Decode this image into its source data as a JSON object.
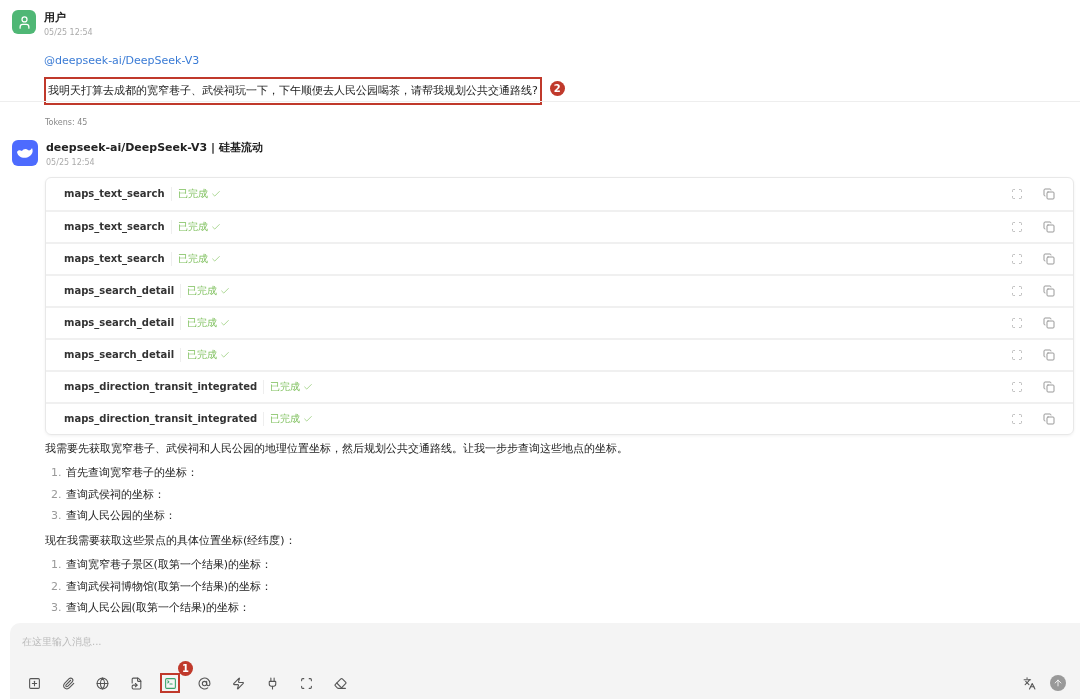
{
  "user_message": {
    "author": "用户",
    "time": "05/25 12:54",
    "mention": "@deepseek-ai/DeepSeek-V3",
    "text": "我明天打算去成都的宽窄巷子、武侯祠玩一下，下午顺便去人民公园喝茶，请帮我规划公共交通路线?",
    "annotation": "2",
    "tokens": "Tokens: 45"
  },
  "assistant_message": {
    "author": "deepseek-ai/DeepSeek-V3 | 硅基流动",
    "time": "05/25 12:54",
    "tool_calls": [
      {
        "name": "maps_text_search",
        "status": "已完成"
      },
      {
        "name": "maps_text_search",
        "status": "已完成"
      },
      {
        "name": "maps_text_search",
        "status": "已完成"
      },
      {
        "name": "maps_search_detail",
        "status": "已完成"
      },
      {
        "name": "maps_search_detail",
        "status": "已完成"
      },
      {
        "name": "maps_search_detail",
        "status": "已完成"
      },
      {
        "name": "maps_direction_transit_integrated",
        "status": "已完成"
      },
      {
        "name": "maps_direction_transit_integrated",
        "status": "已完成"
      }
    ],
    "blocks": [
      {
        "kind": "paragraph",
        "text": "我需要先获取宽窄巷子、武侯祠和人民公园的地理位置坐标，然后规划公共交通路线。让我一步步查询这些地点的坐标。"
      },
      {
        "kind": "list",
        "items": [
          {
            "number": "1.",
            "text": "首先查询宽窄巷子的坐标："
          },
          {
            "number": "2.",
            "text": "查询武侯祠的坐标："
          },
          {
            "number": "3.",
            "text": "查询人民公园的坐标："
          }
        ]
      },
      {
        "kind": "paragraph",
        "text": "现在我需要获取这些景点的具体位置坐标(经纬度)："
      },
      {
        "kind": "list",
        "items": [
          {
            "number": "1.",
            "text": "查询宽窄巷子景区(取第一个结果)的坐标："
          },
          {
            "number": "2.",
            "text": "查询武侯祠博物馆(取第一个结果)的坐标："
          },
          {
            "number": "3.",
            "text": "查询人民公园(取第一个结果)的坐标："
          }
        ]
      }
    ]
  },
  "composer": {
    "placeholder": "在这里输入消息...",
    "tools": [
      {
        "kind": "new-topic"
      },
      {
        "kind": "attach"
      },
      {
        "kind": "web"
      },
      {
        "kind": "file"
      },
      {
        "kind": "terminal",
        "annotation": "1"
      },
      {
        "kind": "mention"
      },
      {
        "kind": "quick"
      },
      {
        "kind": "plugin"
      },
      {
        "kind": "fullscreen"
      },
      {
        "kind": "clear"
      }
    ]
  }
}
